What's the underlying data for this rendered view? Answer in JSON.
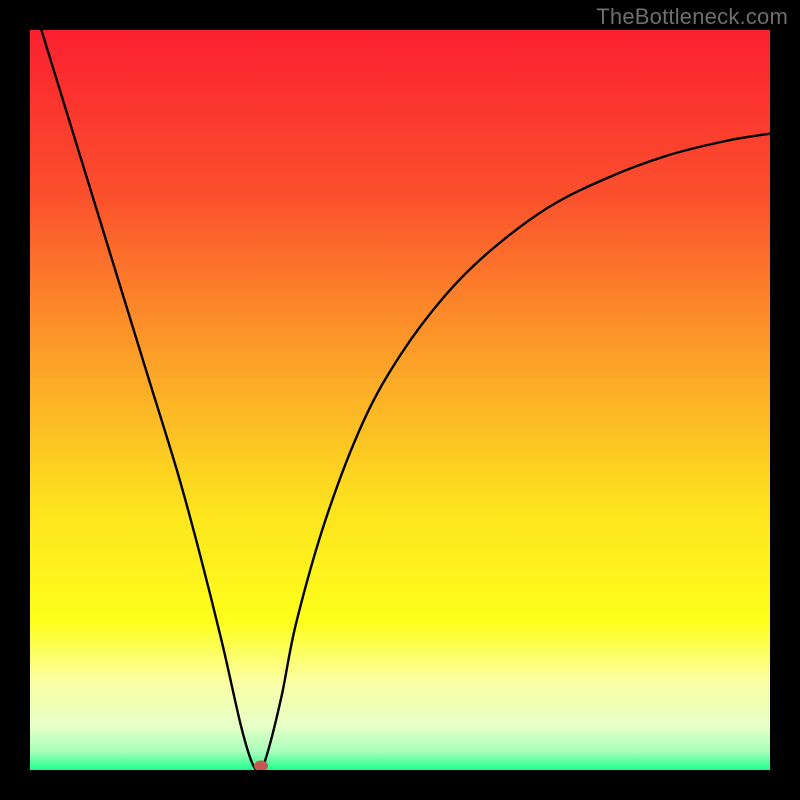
{
  "watermark": "TheBottleneck.com",
  "chart_data": {
    "type": "line",
    "title": "",
    "xlabel": "",
    "ylabel": "",
    "xlim": [
      0,
      100
    ],
    "ylim": [
      0,
      100
    ],
    "gradient_stops": [
      {
        "pos": 0.0,
        "color": "#fb2030"
      },
      {
        "pos": 0.22,
        "color": "#fb4f2d"
      },
      {
        "pos": 0.45,
        "color": "#fca228"
      },
      {
        "pos": 0.65,
        "color": "#fde41e"
      },
      {
        "pos": 0.8,
        "color": "#feff1c"
      },
      {
        "pos": 0.88,
        "color": "#fbffa3"
      },
      {
        "pos": 0.94,
        "color": "#e7ffc8"
      },
      {
        "pos": 0.975,
        "color": "#a7ffba"
      },
      {
        "pos": 1.0,
        "color": "#1cff8a"
      }
    ],
    "series": [
      {
        "name": "bottleneck-curve",
        "x": [
          0,
          4,
          8,
          12,
          16,
          20,
          23,
          26,
          28.5,
          30,
          31,
          32,
          34,
          36,
          40,
          45,
          50,
          56,
          62,
          70,
          78,
          86,
          94,
          100
        ],
        "y": [
          105,
          92,
          79,
          66,
          53,
          40,
          29,
          17,
          6,
          1,
          0,
          2,
          10,
          20,
          34,
          47,
          56,
          64,
          70,
          76,
          80,
          83,
          85,
          86
        ]
      }
    ],
    "marker": {
      "x": 31.2,
      "y": 0.5,
      "color": "#c65a52"
    }
  }
}
